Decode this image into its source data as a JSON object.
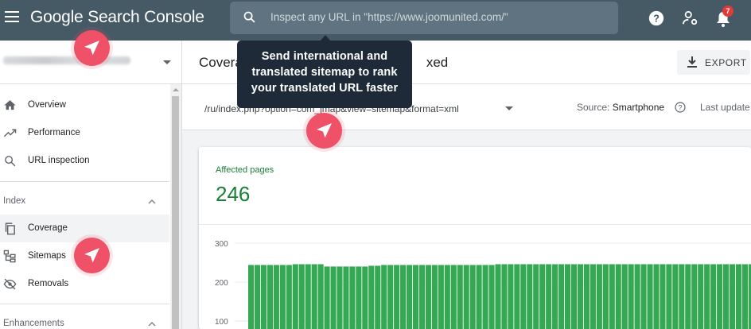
{
  "app": {
    "brand": "Google Search Console",
    "search_placeholder": "Inspect any URL in \"https://www.joomunited.com/\"",
    "notification_count": "7"
  },
  "sidebar": {
    "items": [
      {
        "label": "Overview",
        "icon": "home-icon"
      },
      {
        "label": "Performance",
        "icon": "trending-up-icon"
      },
      {
        "label": "URL inspection",
        "icon": "search-icon"
      }
    ],
    "index_section": "Index",
    "index_items": [
      {
        "label": "Coverage",
        "icon": "copy-icon",
        "active": true
      },
      {
        "label": "Sitemaps",
        "icon": "sitemap-icon"
      },
      {
        "label": "Removals",
        "icon": "eye-off-icon"
      }
    ],
    "enhancements_section": "Enhancements"
  },
  "main": {
    "title_left": "Covera",
    "title_right": "xed",
    "export_label": "EXPORT",
    "sitemap_url": "/ru/index.php?option=com_jmap&view=sitemap&format=xml",
    "source_label": "Source: ",
    "source_value": "Smartphone",
    "last_update": "Last update"
  },
  "card": {
    "affected_label": "Affected pages",
    "affected_value": "246"
  },
  "tooltip": {
    "line1": "Send international and",
    "line2": "translated sitemap to rank",
    "line3": "your translated URL faster"
  },
  "colors": {
    "topbar": "#455a64",
    "bar_green": "#34a853",
    "accent_green": "#188038",
    "marker": "#ef5168",
    "tooltip_bg": "#1e2a38"
  },
  "chart_data": {
    "type": "bar",
    "yticks": [
      "300",
      "200",
      "100"
    ],
    "ylim": [
      0,
      300
    ],
    "values": [
      244,
      244,
      244,
      244,
      244,
      244,
      244,
      246,
      246,
      246,
      246,
      246,
      240,
      240,
      240,
      240,
      240,
      240,
      240,
      242,
      242,
      244,
      244,
      244,
      244,
      244,
      244,
      244,
      244,
      244,
      244,
      244,
      244,
      244,
      244,
      244,
      244,
      244,
      244,
      246,
      246,
      246,
      246,
      246,
      246,
      246,
      246,
      246,
      246,
      246,
      246,
      246,
      246,
      246,
      246,
      246,
      246,
      246,
      246,
      246,
      246,
      246,
      246,
      246,
      246,
      246,
      246,
      246,
      246,
      246,
      246,
      246,
      246,
      246,
      246,
      246,
      246,
      246,
      246,
      246,
      246,
      246
    ]
  }
}
